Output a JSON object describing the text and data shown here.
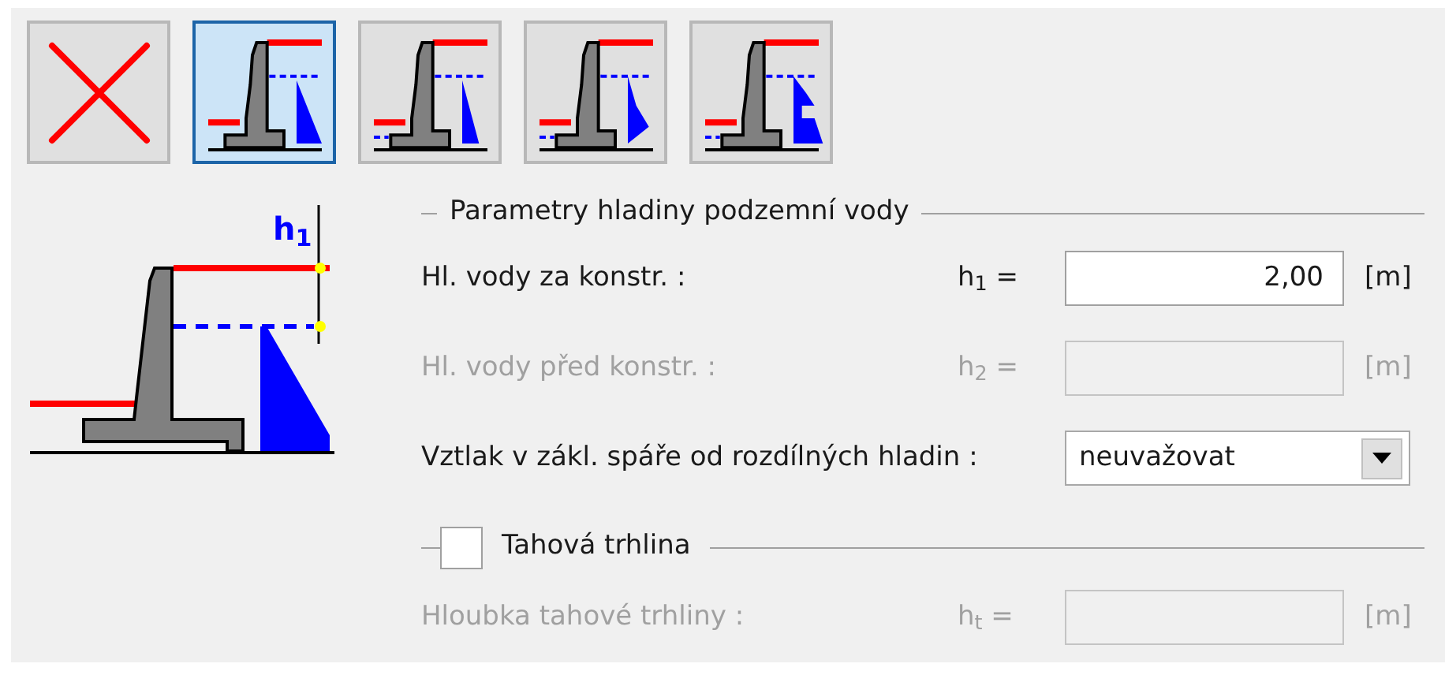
{
  "toolbar": [
    {
      "kind": "none",
      "selected": false
    },
    {
      "kind": "linear",
      "selected": true
    },
    {
      "kind": "linear-front",
      "selected": false
    },
    {
      "kind": "bulge",
      "selected": false
    },
    {
      "kind": "notched",
      "selected": false
    }
  ],
  "diagram": {
    "label": "h$_{1}$"
  },
  "groundwater": {
    "title": "Parametry hladiny podzemní vody",
    "rows": [
      {
        "kind": "input",
        "label": "Hl. vody za konstr. :",
        "symbol": "h$_{1}$ =",
        "value": "2,00",
        "unit": "[m]",
        "disabled": false
      },
      {
        "kind": "input",
        "label": "Hl. vody před konstr. :",
        "symbol": "h$_{2}$ =",
        "unit": "[m]",
        "disabled": true
      },
      {
        "kind": "select",
        "label": "Vztlak v zákl. spáře od rozdílných hladin :",
        "value": "neuvažovat",
        "disabled": false
      }
    ]
  },
  "crack": {
    "title": "Tahová trhlina",
    "checked": false,
    "rows": [
      {
        "kind": "input",
        "label": "Hloubka tahové trhliny :",
        "symbol": "h$_{t}$ =",
        "unit": "[m]",
        "disabled": true
      }
    ]
  }
}
